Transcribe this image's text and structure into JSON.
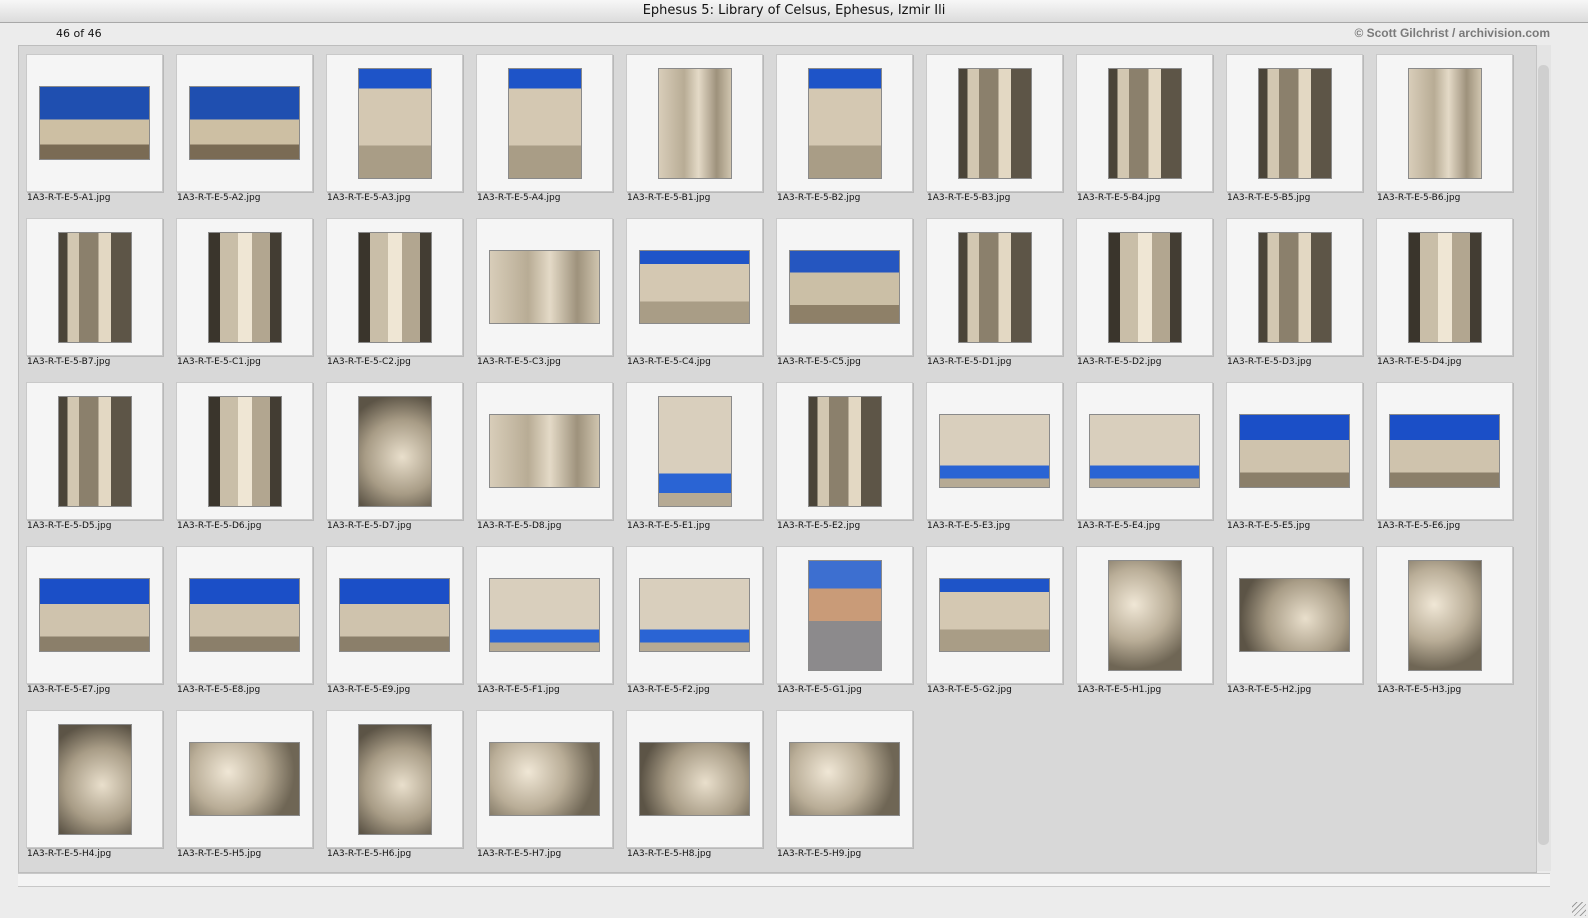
{
  "window": {
    "title": "Ephesus 5: Library of Celsus, Ephesus, Izmir Ili"
  },
  "header": {
    "count": "46 of 46",
    "credit": "© Scott Gilchrist / archivision.com"
  },
  "thumbnails": [
    {
      "file": "1A3-R-T-E-5-A1.jpg",
      "orient": "landscape",
      "style": "sky-wide"
    },
    {
      "file": "1A3-R-T-E-5-A2.jpg",
      "orient": "landscape",
      "style": "sky-wide"
    },
    {
      "file": "1A3-R-T-E-5-A3.jpg",
      "orient": "portrait",
      "style": "facade-sky"
    },
    {
      "file": "1A3-R-T-E-5-A4.jpg",
      "orient": "portrait",
      "style": "facade-sky"
    },
    {
      "file": "1A3-R-T-E-5-B1.jpg",
      "orient": "portrait",
      "style": "facade"
    },
    {
      "file": "1A3-R-T-E-5-B2.jpg",
      "orient": "portrait",
      "style": "facade-sky"
    },
    {
      "file": "1A3-R-T-E-5-B3.jpg",
      "orient": "portrait",
      "style": "column"
    },
    {
      "file": "1A3-R-T-E-5-B4.jpg",
      "orient": "portrait",
      "style": "column"
    },
    {
      "file": "1A3-R-T-E-5-B5.jpg",
      "orient": "portrait",
      "style": "column"
    },
    {
      "file": "1A3-R-T-E-5-B6.jpg",
      "orient": "portrait",
      "style": "facade"
    },
    {
      "file": "1A3-R-T-E-5-B7.jpg",
      "orient": "portrait",
      "style": "column"
    },
    {
      "file": "1A3-R-T-E-5-C1.jpg",
      "orient": "portrait",
      "style": "niche"
    },
    {
      "file": "1A3-R-T-E-5-C2.jpg",
      "orient": "portrait",
      "style": "niche"
    },
    {
      "file": "1A3-R-T-E-5-C3.jpg",
      "orient": "landscape",
      "style": "facade"
    },
    {
      "file": "1A3-R-T-E-5-C4.jpg",
      "orient": "landscape",
      "style": "facade-sky"
    },
    {
      "file": "1A3-R-T-E-5-C5.jpg",
      "orient": "landscape",
      "style": "sky-top"
    },
    {
      "file": "1A3-R-T-E-5-D1.jpg",
      "orient": "portrait",
      "style": "column"
    },
    {
      "file": "1A3-R-T-E-5-D2.jpg",
      "orient": "portrait",
      "style": "niche"
    },
    {
      "file": "1A3-R-T-E-5-D3.jpg",
      "orient": "portrait",
      "style": "column"
    },
    {
      "file": "1A3-R-T-E-5-D4.jpg",
      "orient": "portrait",
      "style": "niche"
    },
    {
      "file": "1A3-R-T-E-5-D5.jpg",
      "orient": "portrait",
      "style": "column"
    },
    {
      "file": "1A3-R-T-E-5-D6.jpg",
      "orient": "portrait",
      "style": "niche"
    },
    {
      "file": "1A3-R-T-E-5-D7.jpg",
      "orient": "portrait",
      "style": "relief2"
    },
    {
      "file": "1A3-R-T-E-5-D8.jpg",
      "orient": "landscape",
      "style": "facade"
    },
    {
      "file": "1A3-R-T-E-5-E1.jpg",
      "orient": "portrait",
      "style": "low-sky"
    },
    {
      "file": "1A3-R-T-E-5-E2.jpg",
      "orient": "portrait",
      "style": "column"
    },
    {
      "file": "1A3-R-T-E-5-E3.jpg",
      "orient": "landscape",
      "style": "low-sky"
    },
    {
      "file": "1A3-R-T-E-5-E4.jpg",
      "orient": "landscape",
      "style": "low-sky"
    },
    {
      "file": "1A3-R-T-E-5-E5.jpg",
      "orient": "landscape",
      "style": "frieze-sky"
    },
    {
      "file": "1A3-R-T-E-5-E6.jpg",
      "orient": "landscape",
      "style": "frieze-sky"
    },
    {
      "file": "1A3-R-T-E-5-E7.jpg",
      "orient": "landscape",
      "style": "frieze-sky"
    },
    {
      "file": "1A3-R-T-E-5-E8.jpg",
      "orient": "landscape",
      "style": "frieze-sky"
    },
    {
      "file": "1A3-R-T-E-5-E9.jpg",
      "orient": "landscape",
      "style": "frieze-sky"
    },
    {
      "file": "1A3-R-T-E-5-F1.jpg",
      "orient": "landscape",
      "style": "low-sky"
    },
    {
      "file": "1A3-R-T-E-5-F2.jpg",
      "orient": "landscape",
      "style": "low-sky"
    },
    {
      "file": "1A3-R-T-E-5-G1.jpg",
      "orient": "portrait",
      "style": "people"
    },
    {
      "file": "1A3-R-T-E-5-G2.jpg",
      "orient": "landscape",
      "style": "facade-sky"
    },
    {
      "file": "1A3-R-T-E-5-H1.jpg",
      "orient": "portrait",
      "style": "relief"
    },
    {
      "file": "1A3-R-T-E-5-H2.jpg",
      "orient": "landscape",
      "style": "relief2"
    },
    {
      "file": "1A3-R-T-E-5-H3.jpg",
      "orient": "portrait",
      "style": "relief"
    },
    {
      "file": "1A3-R-T-E-5-H4.jpg",
      "orient": "portrait",
      "style": "relief2"
    },
    {
      "file": "1A3-R-T-E-5-H5.jpg",
      "orient": "landscape",
      "style": "relief"
    },
    {
      "file": "1A3-R-T-E-5-H6.jpg",
      "orient": "portrait",
      "style": "relief2"
    },
    {
      "file": "1A3-R-T-E-5-H7.jpg",
      "orient": "landscape",
      "style": "relief"
    },
    {
      "file": "1A3-R-T-E-5-H8.jpg",
      "orient": "landscape",
      "style": "relief2"
    },
    {
      "file": "1A3-R-T-E-5-H9.jpg",
      "orient": "landscape",
      "style": "relief"
    }
  ]
}
